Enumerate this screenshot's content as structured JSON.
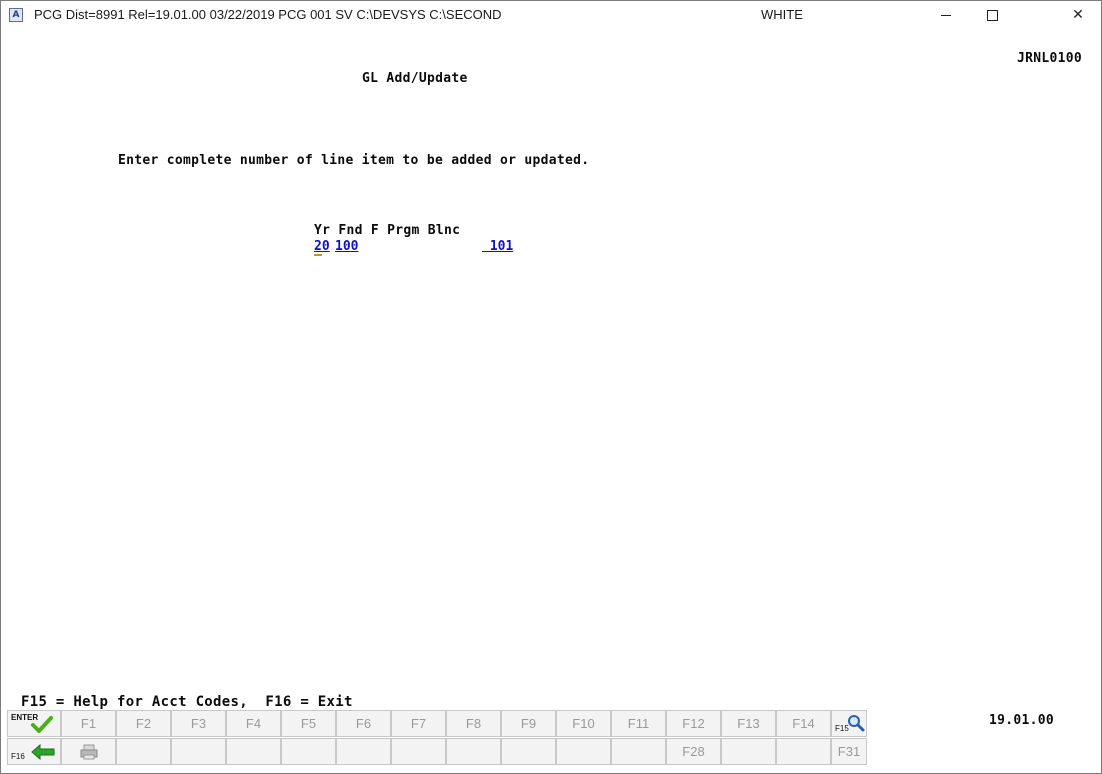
{
  "window": {
    "title": "PCG Dist=8991  Rel=19.01.00  03/22/2019  PCG 001  SV  C:\\DEVSYS   C:\\SECOND",
    "user": "WHITE",
    "app_icon": "A",
    "minimize_icon": "minimize-icon",
    "maximize_icon": "maximize-icon",
    "close_icon": "close-icon"
  },
  "screen": {
    "id": "JRNL0100",
    "title": "GL Add/Update",
    "prompt": "Enter complete number of line item to be added or updated.",
    "column_headers": "Yr Fnd F Prgm Blnc",
    "fields": {
      "yr": "20",
      "fnd": "100",
      "blnc": " 101"
    },
    "help_line": "F15 = Help for Acct Codes,  F16 = Exit",
    "version": "19.01.00"
  },
  "function_keys": {
    "row1": [
      {
        "label": "ENTER",
        "icon": "enter-checkmark-icon"
      },
      {
        "label": "F1"
      },
      {
        "label": "F2"
      },
      {
        "label": "F3"
      },
      {
        "label": "F4"
      },
      {
        "label": "F5"
      },
      {
        "label": "F6"
      },
      {
        "label": "F7"
      },
      {
        "label": "F8"
      },
      {
        "label": "F9"
      },
      {
        "label": "F10"
      },
      {
        "label": "F11"
      },
      {
        "label": "F12"
      },
      {
        "label": "F13"
      },
      {
        "label": "F14"
      },
      {
        "label": "F15",
        "icon": "magnifier-icon"
      }
    ],
    "row2": [
      {
        "label": "F16",
        "icon": "exit-arrow-icon"
      },
      {
        "label": "",
        "icon": "printer-icon"
      },
      {
        "label": ""
      },
      {
        "label": ""
      },
      {
        "label": ""
      },
      {
        "label": ""
      },
      {
        "label": ""
      },
      {
        "label": ""
      },
      {
        "label": ""
      },
      {
        "label": ""
      },
      {
        "label": ""
      },
      {
        "label": ""
      },
      {
        "label": "F28"
      },
      {
        "label": ""
      },
      {
        "label": ""
      },
      {
        "label": "F31"
      }
    ]
  },
  "colors": {
    "field_text": "#1010c8",
    "enter_check": "#4caf1a",
    "exit_arrow": "#2aa52a",
    "magnifier": "#2a5fb0"
  }
}
